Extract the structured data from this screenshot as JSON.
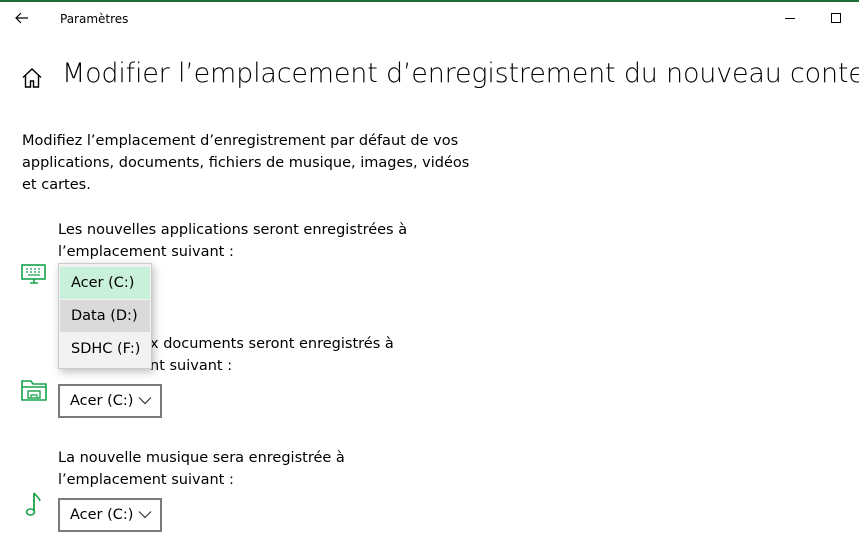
{
  "window": {
    "title": "Paramètres",
    "accent": "#16a34a"
  },
  "header": {
    "title": "Modifier l’emplacement d’enregistrement du nouveau contenu"
  },
  "description": "Modifiez l’emplacement d’enregistrement par défaut de vos applications, documents, fichiers de musique, images, vidéos et cartes.",
  "sections": [
    {
      "icon": "monitor-icon",
      "label": "Les nouvelles applications seront enregistrées à l’emplacement suivant :",
      "value": "Acer (C:)"
    },
    {
      "icon": "folder-drive-icon",
      "label_visible": "x documents seront enregistrés à",
      "label_visible_line2": "nt suivant :",
      "value": "Acer (C:)"
    },
    {
      "icon": "music-note-icon",
      "label": "La nouvelle musique sera enregistrée à l’emplacement suivant :",
      "value": "Acer (C:)"
    }
  ],
  "dropdown": {
    "options": [
      "Acer (C:)",
      "Data (D:)",
      "SDHC (F:)"
    ],
    "selected": "Acer (C:)",
    "hovered": "Data (D:)",
    "selected_color": "#c9f0da"
  }
}
